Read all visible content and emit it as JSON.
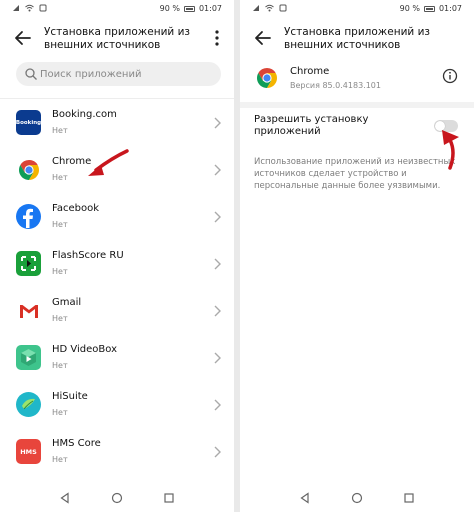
{
  "status_bar": {
    "battery": "90 %",
    "time": "01:07"
  },
  "left": {
    "title": "Установка приложений из внешних источников",
    "search_placeholder": "Поиск приложений",
    "apps": [
      {
        "name": "Booking.com",
        "status": "Нет",
        "icon": "booking-icon",
        "color": "#0b3b8f"
      },
      {
        "name": "Chrome",
        "status": "Нет",
        "icon": "chrome-icon",
        "color": "#ffffff"
      },
      {
        "name": "Facebook",
        "status": "Нет",
        "icon": "facebook-icon",
        "color": "#1877f2"
      },
      {
        "name": "FlashScore RU",
        "status": "Нет",
        "icon": "flashscore-icon",
        "color": "#1aa03a"
      },
      {
        "name": "Gmail",
        "status": "Нет",
        "icon": "gmail-icon",
        "color": "#ffffff"
      },
      {
        "name": "HD VideoBox",
        "status": "Нет",
        "icon": "hd-videobox-icon",
        "color": "#3ec48c"
      },
      {
        "name": "HiSuite",
        "status": "Нет",
        "icon": "hisuite-icon",
        "color": "#20b7c9"
      },
      {
        "name": "HMS Core",
        "status": "Нет",
        "icon": "hms-core-icon",
        "color": "#e8453c"
      }
    ]
  },
  "right": {
    "title": "Установка приложений из внешних источников",
    "app_name": "Chrome",
    "app_version": "Версия 85.0.4183.101",
    "setting_label": "Разрешить установку приложений",
    "toggle_on": false,
    "description": "Использование приложений из неизвестных источников сделает устройство и персональные данные более уязвимыми."
  },
  "booking_logo_text": "Booking",
  "hms_logo_text": "HMS",
  "accent_arrow_color": "#c8161d"
}
